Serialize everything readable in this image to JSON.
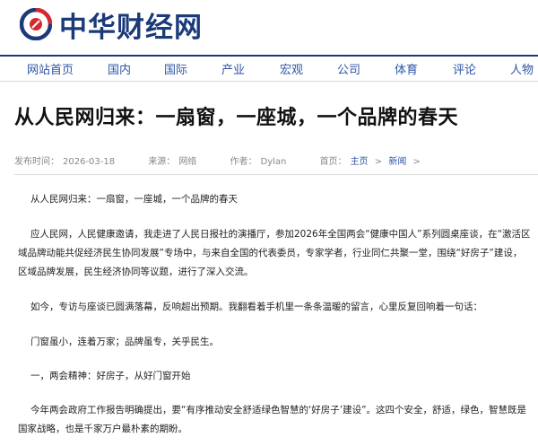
{
  "site": {
    "name": "中华财经网"
  },
  "nav": {
    "items": [
      "网站首页",
      "国内",
      "国际",
      "产业",
      "宏观",
      "公司",
      "体育",
      "评论",
      "人物"
    ]
  },
  "article": {
    "title": "从人民网归来：一扇窗，一座城，一个品牌的春天",
    "meta": {
      "published_label": "发布时间：",
      "published": "2026-03-18",
      "source_label": "来源：",
      "source": "网络",
      "author_label": "作者：",
      "author": "Dylan",
      "breadcrumb_label": "首页：",
      "crumb_home": "主页",
      "crumb_sep": ">",
      "crumb_news": "新闻",
      "crumb_end": ">"
    },
    "paragraphs": [
      "从人民网归来：一扇窗，一座城，一个品牌的春天",
      "应人民网，人民健康邀请，我走进了人民日报社的演播厅，参加2026年全国两会“健康中国人”系列圆桌座谈，在“激活区域品牌动能共促经济民生协同发展”专场中，与来自全国的代表委员，专家学者，行业同仁共聚一堂，围绕“好房子”建设，区域品牌发展，民生经济协同等议题，进行了深入交流。",
      "如今，专访与座谈已圆满落幕，反响超出预期。我翻看着手机里一条条温暖的留言，心里反复回响着一句话：",
      "门窗虽小，连着万家；品牌虽专，关乎民生。",
      "一，两会精神：好房子，从好门窗开始",
      "今年两会政府工作报告明确提出，要“有序推动安全舒适绿色智慧的‘好房子’建设”。这四个安全，舒适，绿色，智慧既是国家战略，也是千家万户最朴素的期盼。"
    ]
  },
  "colors": {
    "brand": "#1b3a7a",
    "link": "#2d55a8",
    "logo_red": "#d7282f"
  },
  "icons": {
    "logo": "china-finance-logo-icon"
  }
}
